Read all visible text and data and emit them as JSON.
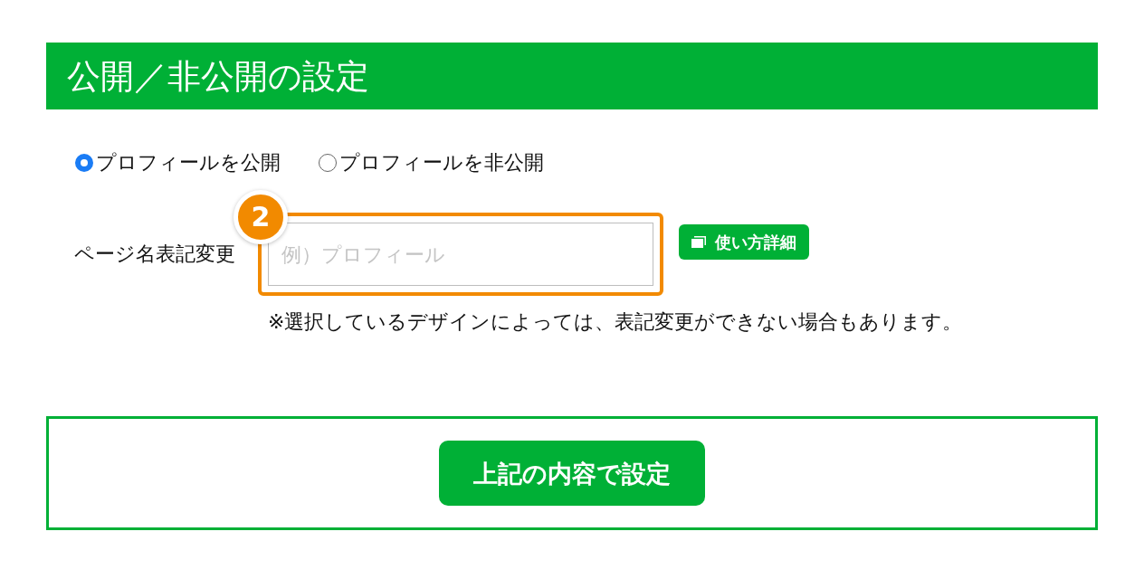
{
  "section": {
    "title": "公開／非公開の設定"
  },
  "visibility_options": [
    {
      "label": "プロフィールを公開",
      "selected": true
    },
    {
      "label": "プロフィールを非公開",
      "selected": false
    }
  ],
  "page_name": {
    "label": "ページ名表記変更",
    "placeholder": "例）プロフィール",
    "help_button": "使い方詳細",
    "note": "※選択しているデザインによっては、表記変更ができない場合もあります。"
  },
  "annotation": {
    "number": "2"
  },
  "submit_button": "上記の内容で設定"
}
